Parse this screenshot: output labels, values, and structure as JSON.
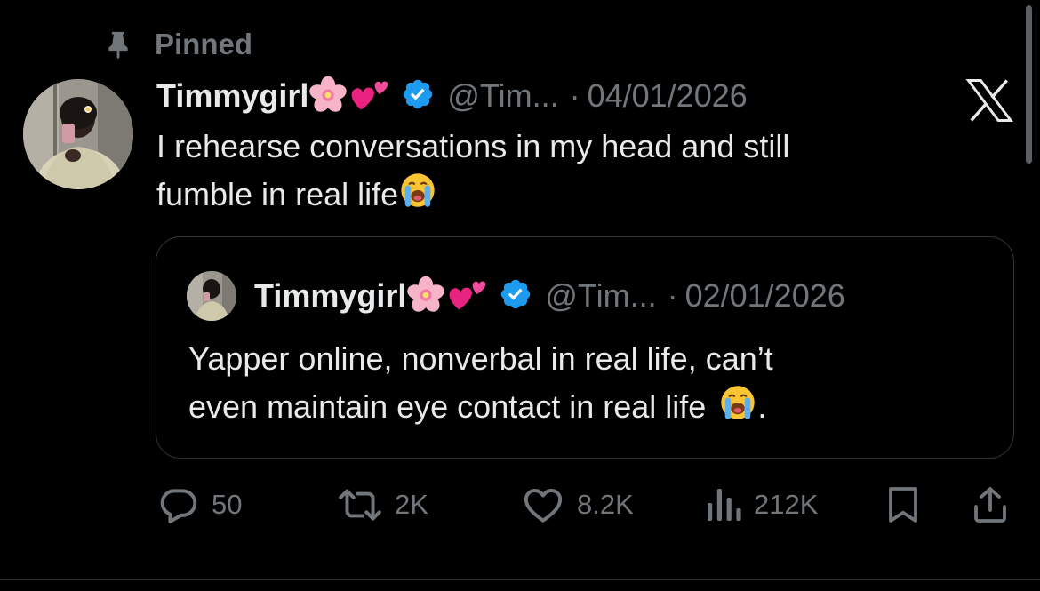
{
  "pinned": {
    "label": "Pinned",
    "icon": "pin-icon"
  },
  "tweet": {
    "display_name": "Timmygirl",
    "name_emojis": [
      "cherry-blossom-emoji",
      "two-hearts-emoji"
    ],
    "verified": true,
    "handle": "@Tim...",
    "separator": "·",
    "date": "04/01/2026",
    "text_lines": [
      "I rehearse conversations in my head and still",
      "fumble in real life"
    ],
    "text_trailing_emoji": "loudly-crying-face-emoji"
  },
  "quoted_tweet": {
    "display_name": "Timmygirl",
    "handle": "@Tim...",
    "separator": "·",
    "date": "02/01/2026",
    "text_lines": [
      "Yapper online, nonverbal in real life, can’t",
      "even maintain eye contact in real life"
    ],
    "text_trailing_emoji": "loudly-crying-face-emoji",
    "text_end": "."
  },
  "actions": {
    "reply_count": "50",
    "repost_count": "2K",
    "like_count": "8.2K",
    "views_count": "212K"
  },
  "colors": {
    "background": "#000000",
    "primary_text": "#e7e9ea",
    "secondary_text": "#71767b",
    "verified_blue": "#1d9bf0",
    "border": "#2f3336"
  },
  "brand_icon": "x-logo-icon"
}
